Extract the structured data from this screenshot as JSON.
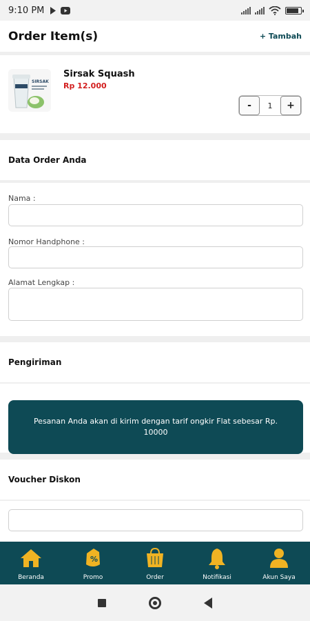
{
  "status": {
    "time": "9:10 PM"
  },
  "header": {
    "title": "Order Item(s)",
    "add_label": "+ Tambah"
  },
  "item": {
    "name": "Sirsak Squash",
    "price": "Rp 12.000",
    "qty": "1",
    "minus": "-",
    "plus": "+",
    "thumb_text": "SIRSAK"
  },
  "sections": {
    "data_order": "Data Order Anda",
    "shipping": "Pengiriman",
    "voucher": "Voucher Diskon"
  },
  "form": {
    "name_label": "Nama :",
    "phone_label": "Nomor Handphone :",
    "address_label": "Alamat Lengkap :"
  },
  "shipping_note": "Pesanan Anda akan di kirim dengan tarif ongkir Flat sebesar Rp. 10000",
  "nav": {
    "items": [
      {
        "label": "Beranda",
        "icon": "home-icon"
      },
      {
        "label": "Promo",
        "icon": "promo-tag-icon"
      },
      {
        "label": "Order",
        "icon": "shopping-bag-icon"
      },
      {
        "label": "Notifikasi",
        "icon": "bell-icon"
      },
      {
        "label": "Akun Saya",
        "icon": "user-icon"
      }
    ]
  },
  "colors": {
    "primary": "#0e4a55",
    "accent": "#f0b323",
    "price": "#d21e1e"
  }
}
